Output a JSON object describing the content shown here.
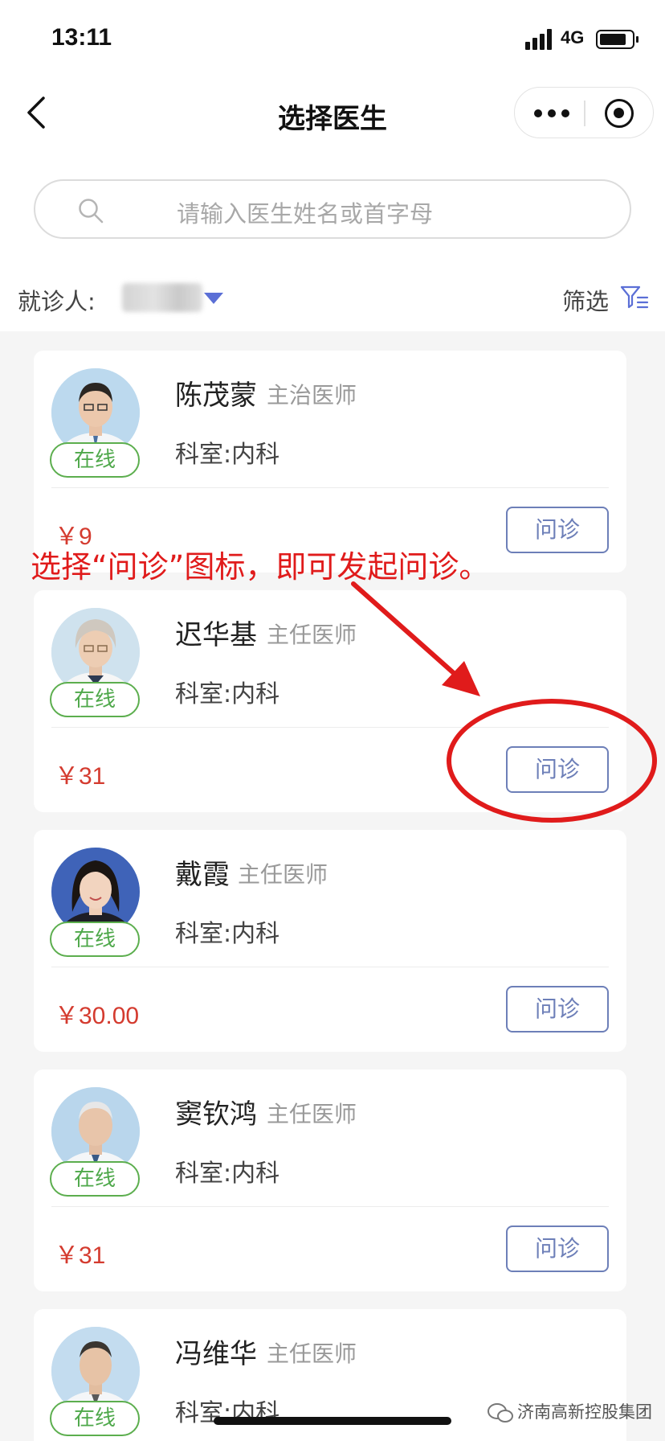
{
  "status_bar": {
    "time": "13:11",
    "network": "4G",
    "battery_level": 0.72
  },
  "nav": {
    "title": "选择医生"
  },
  "search": {
    "placeholder": "请输入医生姓名或首字母"
  },
  "patient": {
    "label": "就诊人:"
  },
  "filter": {
    "label": "筛选"
  },
  "doctors": [
    {
      "name": "陈茂蒙",
      "title": "主治医师",
      "department": "科室:内科",
      "status": "在线",
      "price": "￥9",
      "action": "问诊"
    },
    {
      "name": "迟华基",
      "title": "主任医师",
      "department": "科室:内科",
      "status": "在线",
      "price": "￥31",
      "action": "问诊"
    },
    {
      "name": "戴霞",
      "title": "主任医师",
      "department": "科室:内科",
      "status": "在线",
      "price": "￥30.00",
      "action": "问诊"
    },
    {
      "name": "窦钦鸿",
      "title": "主任医师",
      "department": "科室:内科",
      "status": "在线",
      "price": "￥31",
      "action": "问诊"
    },
    {
      "name": "冯维华",
      "title": "主任医师",
      "department": "科室:内科",
      "status": "在线"
    }
  ],
  "annotation": {
    "text": "选择“问诊”图标，即可发起问诊。",
    "color": "#e01b1b"
  },
  "watermark": {
    "text": "济南高新控股集团"
  },
  "colors": {
    "accent": "#6d7fb8",
    "price": "#d43b2f",
    "online": "#4ea84a",
    "caret": "#5b6fd6"
  }
}
